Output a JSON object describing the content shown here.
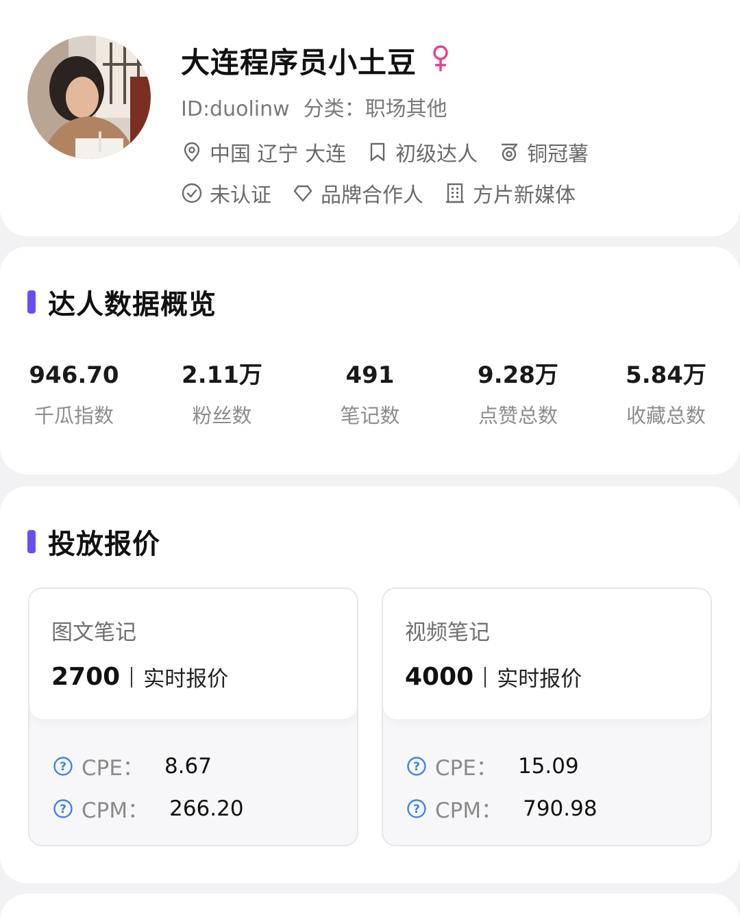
{
  "profile": {
    "name": "大连程序员小土豆",
    "id_text": "ID:duolinw",
    "category_text": "分类：",
    "category_value": "职场其他",
    "location": "中国 辽宁 大连",
    "level": "初级达人",
    "rank": "铜冠薯",
    "verification": "未认证",
    "brand_partner": "品牌合作人",
    "agency": "方片新媒体",
    "accent_color": "#e8418f"
  },
  "overview": {
    "title": "达人数据概览",
    "stats": [
      {
        "value": "946.70",
        "label": "千瓜指数"
      },
      {
        "value": "2.11万",
        "label": "粉丝数"
      },
      {
        "value": "491",
        "label": "笔记数"
      },
      {
        "value": "9.28万",
        "label": "点赞总数"
      },
      {
        "value": "5.84万",
        "label": "收藏总数"
      }
    ]
  },
  "quotes": {
    "title": "投放报价",
    "accent_color": "#6b4cf5",
    "items": [
      {
        "type": "图文笔记",
        "price": "2700",
        "note": "实时报价",
        "cpe_label": "CPE：",
        "cpe_value": "8.67",
        "cpm_label": "CPM：",
        "cpm_value": "266.20"
      },
      {
        "type": "视频笔记",
        "price": "4000",
        "note": "实时报价",
        "cpe_label": "CPE：",
        "cpe_value": "15.09",
        "cpm_label": "CPM：",
        "cpm_value": "790.98"
      }
    ]
  },
  "icons": {
    "gender": "female-icon",
    "location": "location-pin-icon",
    "level": "bookmark-icon",
    "rank": "medal-icon",
    "verification": "check-circle-icon",
    "brand": "diamond-icon",
    "agency": "building-icon",
    "help": "question-circle-icon"
  }
}
